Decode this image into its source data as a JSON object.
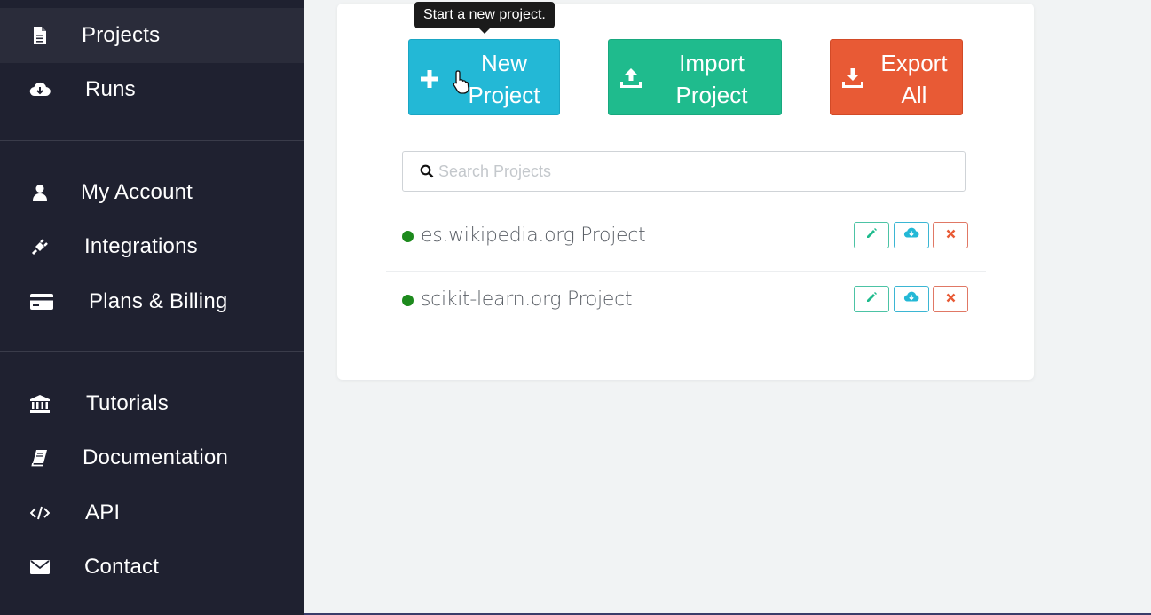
{
  "sidebar": {
    "items": [
      {
        "label": "Projects",
        "icon": "document-icon"
      },
      {
        "label": "Runs",
        "icon": "cloud-download-icon"
      },
      {
        "label": "My Account",
        "icon": "user-icon"
      },
      {
        "label": "Integrations",
        "icon": "plug-icon"
      },
      {
        "label": "Plans & Billing",
        "icon": "credit-card-icon"
      },
      {
        "label": "Tutorials",
        "icon": "institution-icon"
      },
      {
        "label": "Documentation",
        "icon": "book-icon"
      },
      {
        "label": "API",
        "icon": "code-icon"
      },
      {
        "label": "Contact",
        "icon": "envelope-icon"
      }
    ]
  },
  "toolbar": {
    "new_project_line1": "New",
    "new_project_line2": "Project",
    "import_project_line1": "Import",
    "import_project_line2": "Project",
    "export_all_line1": "Export",
    "export_all_line2": "All",
    "tooltip": "Start a new project."
  },
  "search": {
    "placeholder": "Search Projects",
    "value": ""
  },
  "projects": [
    {
      "name": "es.wikipedia.org Project",
      "status_color": "#1d8a1d"
    },
    {
      "name": "scikit-learn.org Project",
      "status_color": "#1d8a1d"
    }
  ],
  "colors": {
    "sidebar_bg": "#1f2130",
    "new_project": "#23b8d6",
    "import_project": "#1fbb8d",
    "export_all": "#e85a35",
    "page_bg": "#f1f3f4"
  }
}
